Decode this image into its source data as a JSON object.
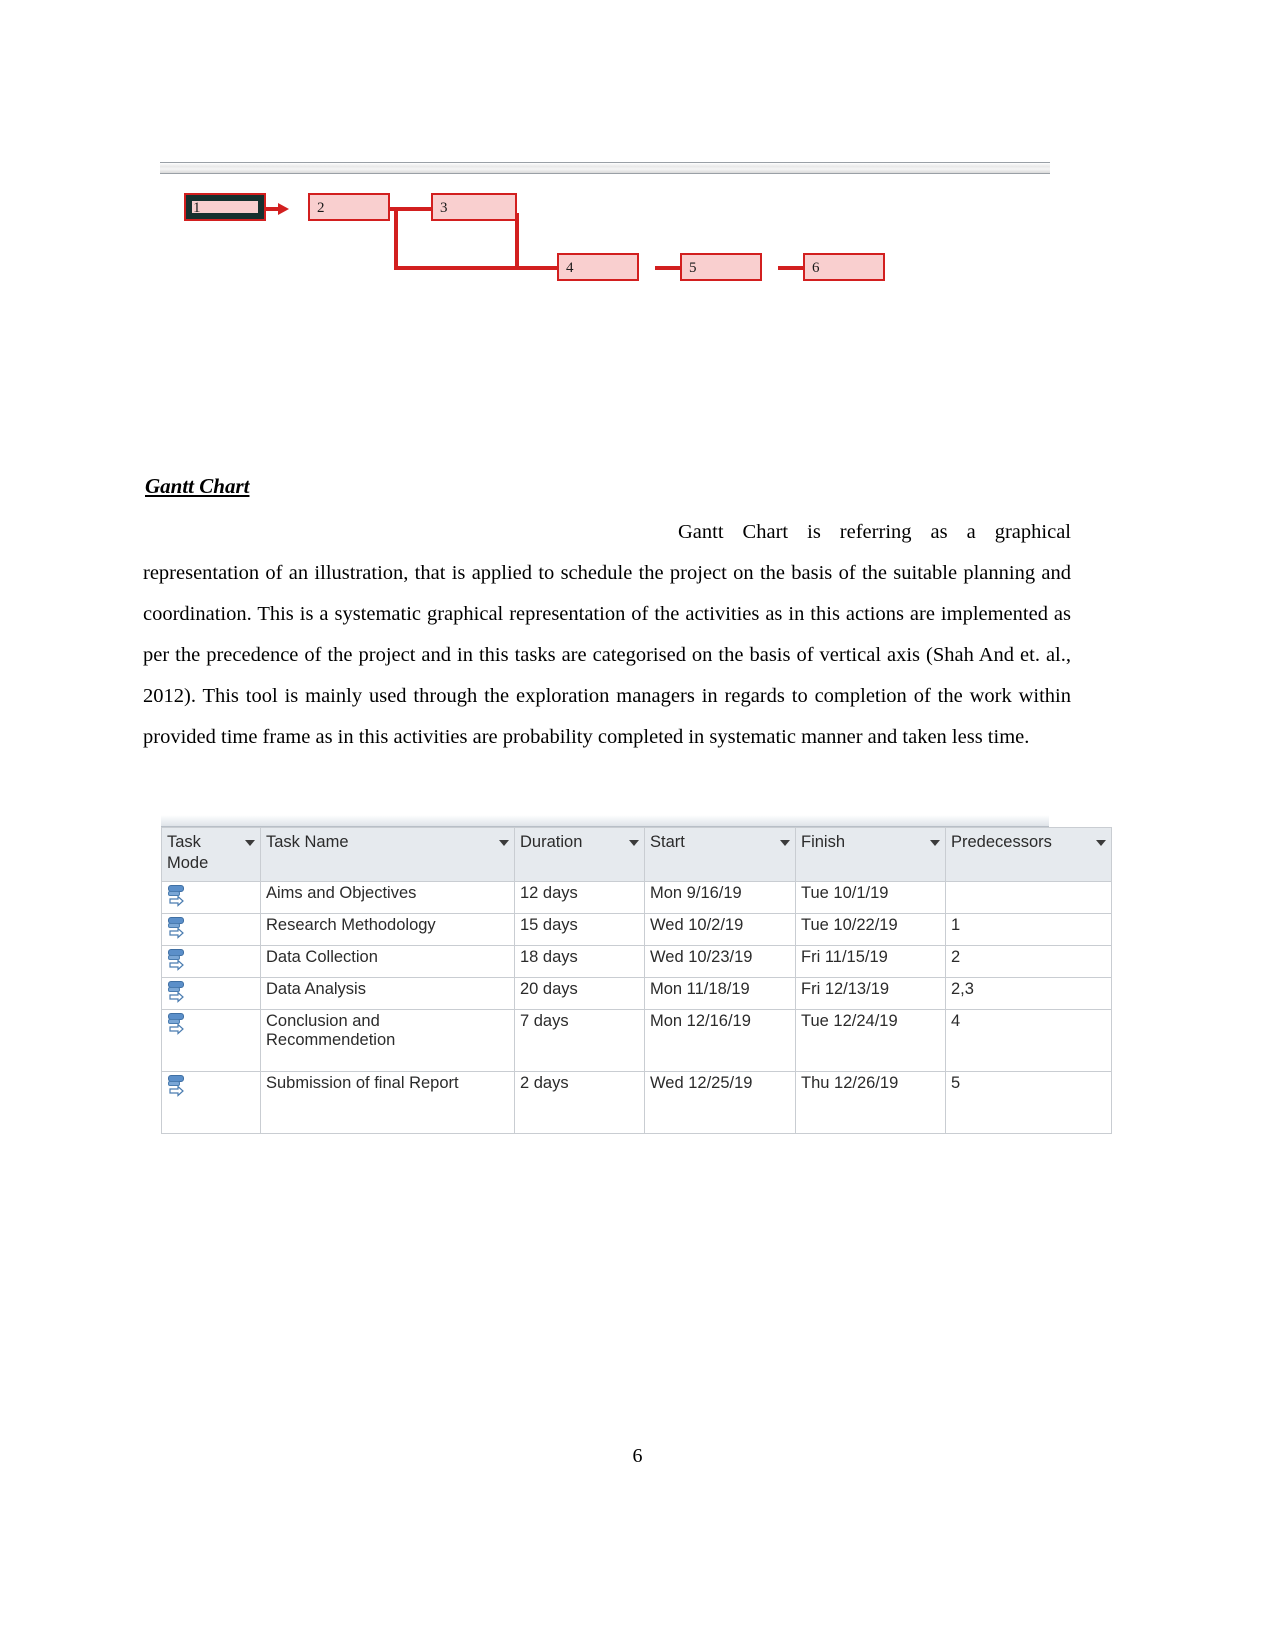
{
  "document": {
    "page_number": "6",
    "heading": "Gantt Chart",
    "paragraph": "Gantt Chart is referring as a graphical representation of an illustration, that is applied to schedule the project on the basis of the suitable planning and coordination. This is a systematic graphical representation of the activities as in this actions are implemented as per the precedence of the project and in this tasks are categorised on the basis of vertical axis (Shah And et. al., 2012). This tool is mainly used through the exploration managers in regards to completion of the work within provided time frame as in this activities are probability completed in systematic manner and taken less time."
  },
  "network_diagram": {
    "colors": {
      "node_fill": "#f9cfcf",
      "node_border": "#d21f1f",
      "connector": "#d21f1f",
      "selection_border": "#16302e"
    },
    "nodes": [
      {
        "label": "1",
        "selected": true
      },
      {
        "label": "2",
        "selected": false
      },
      {
        "label": "3",
        "selected": false
      },
      {
        "label": "4",
        "selected": false
      },
      {
        "label": "5",
        "selected": false
      },
      {
        "label": "6",
        "selected": false
      }
    ]
  },
  "project_table": {
    "highlight_color": "#ffd766",
    "selected_cell_color": "#e4eef7",
    "columns": [
      {
        "label": "Task\nMode",
        "has_filter": true,
        "highlighted": false
      },
      {
        "label": "Task Name",
        "has_filter": true,
        "highlighted": false
      },
      {
        "label": "Duration",
        "has_filter": true,
        "highlighted": false
      },
      {
        "label": "Start",
        "has_filter": true,
        "highlighted": false
      },
      {
        "label": "Finish",
        "has_filter": true,
        "highlighted": false
      },
      {
        "label": "Predecessors",
        "has_filter": true,
        "highlighted": true
      }
    ],
    "rows": [
      {
        "mode_icon": "auto-schedule-icon",
        "task_name": "Aims and Objectives",
        "duration": "12 days",
        "start": "Mon 9/16/19",
        "finish": "Tue 10/1/19",
        "predecessors": ""
      },
      {
        "mode_icon": "auto-schedule-icon",
        "task_name": "Research Methodology",
        "duration": "15 days",
        "start": "Wed 10/2/19",
        "finish": "Tue 10/22/19",
        "predecessors": "1"
      },
      {
        "mode_icon": "auto-schedule-icon",
        "task_name": "Data Collection",
        "duration": "18 days",
        "start": "Wed 10/23/19",
        "finish": "Fri 11/15/19",
        "predecessors": "2"
      },
      {
        "mode_icon": "auto-schedule-icon",
        "task_name": "Data Analysis",
        "duration": "20 days",
        "start": "Mon 11/18/19",
        "finish": "Fri 12/13/19",
        "predecessors": "2,3"
      },
      {
        "mode_icon": "auto-schedule-icon",
        "task_name": "Conclusion and Recommendetion",
        "duration": "7 days",
        "start": "Mon 12/16/19",
        "finish": "Tue 12/24/19",
        "predecessors": "4"
      },
      {
        "mode_icon": "auto-schedule-icon",
        "task_name": "Submission of final Report",
        "duration": "2 days",
        "start": "Wed 12/25/19",
        "finish": "Thu 12/26/19",
        "predecessors": "5"
      }
    ]
  }
}
